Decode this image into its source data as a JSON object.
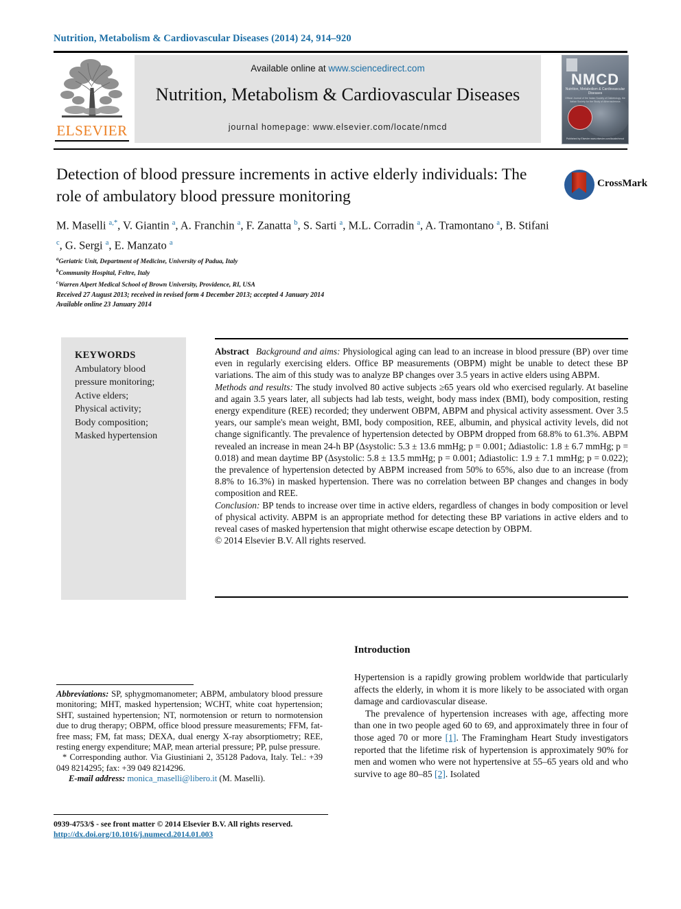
{
  "running_head": {
    "journal": "Nutrition, Metabolism & Cardiovascular Diseases",
    "citation": "(2014) ",
    "volume": "24",
    "pages": ", 914–920"
  },
  "masthead": {
    "available_prefix": "Available online at ",
    "sciencedirect_url": "www.sciencedirect.com",
    "journal_title": "Nutrition, Metabolism & Cardiovascular Diseases",
    "homepage": "journal homepage: www.elsevier.com/locate/nmcd",
    "publisher_name": "ELSEVIER",
    "cover": {
      "acronym": "NMCD",
      "subtitle": "Nutrition, Metabolism &\nCardiovascular Diseases",
      "tagline": "Official Journal of the Italian Society of Diabetology,\nthe Italian Society for the Study of Atherosclerosis",
      "footer": "Published by Elsevier\nwww.elsevier.com/locate/nmcd"
    }
  },
  "article": {
    "title": "Detection of blood pressure increments in active elderly individuals: The role of ambulatory blood pressure monitoring",
    "crossmark_label": "CrossMark",
    "authors": "M. Maselli a,*, V. Giantin a, A. Franchin a, F. Zanatta b, S. Sarti a, M.L. Corradin a, A. Tramontano a, B. Stifani c, G. Sergi a, E. Manzato a",
    "affiliations": [
      {
        "marker": "a",
        "text": "Geriatric Unit, Department of Medicine, University of Padua, Italy"
      },
      {
        "marker": "b",
        "text": "Community Hospital, Feltre, Italy"
      },
      {
        "marker": "c",
        "text": "Warren Alpert Medical School of Brown University, Providence, RI, USA"
      }
    ],
    "history_received": "Received 27 August 2013; received in revised form 4 December 2013; accepted 4 January 2014",
    "history_online": "Available online 23 January 2014"
  },
  "keywords": {
    "heading": "KEYWORDS",
    "items": [
      "Ambulatory blood pressure monitoring;",
      "Active elders;",
      "Physical activity;",
      "Body composition;",
      "Masked hypertension"
    ]
  },
  "abstract": {
    "label": "Abstract",
    "background_label": "Background and aims:",
    "background_text": " Physiological aging can lead to an increase in blood pressure (BP) over time even in regularly exercising elders. Office BP measurements (OBPM) might be unable to detect these BP variations. The aim of this study was to analyze BP changes over 3.5 years in active elders using ABPM.",
    "methods_label": "Methods and results:",
    "methods_text": " The study involved 80 active subjects ≥65 years old who exercised regularly. At baseline and again 3.5 years later, all subjects had lab tests, weight, body mass index (BMI), body composition, resting energy expenditure (REE) recorded; they underwent OBPM, ABPM and physical activity assessment. Over 3.5 years, our sample's mean weight, BMI, body composition, REE, albumin, and physical activity levels, did not change significantly. The prevalence of hypertension detected by OBPM dropped from 68.8% to 61.3%. ABPM revealed an increase in mean 24-h BP (Δsystolic: 5.3 ± 13.6 mmHg; p = 0.001; Δdiastolic: 1.8 ± 6.7 mmHg; p = 0.018) and mean daytime BP (Δsystolic: 5.8 ± 13.5 mmHg; p = 0.001; Δdiastolic: 1.9 ± 7.1 mmHg; p = 0.022); the prevalence of hypertension detected by ABPM increased from 50% to 65%, also due to an increase (from 8.8% to 16.3%) in masked hypertension. There was no correlation between BP changes and changes in body composition and REE.",
    "conclusion_label": "Conclusion:",
    "conclusion_text": " BP tends to increase over time in active elders, regardless of changes in body composition or level of physical activity. ABPM is an appropriate method for detecting these BP variations in active elders and to reveal cases of masked hypertension that might otherwise escape detection by OBPM.",
    "copyright": "© 2014 Elsevier B.V. All rights reserved."
  },
  "abbreviations": {
    "label": "Abbreviations:",
    "text": " SP, sphygmomanometer; ABPM, ambulatory blood pressure monitoring; MHT, masked hypertension; WCHT, white coat hypertension; SHT, sustained hypertension; NT, normotension or return to normotension due to drug therapy; OBPM, office blood pressure measurements; FFM, fat-free mass; FM, fat mass; DEXA, dual energy X-ray absorptiometry; REE, resting energy expenditure; MAP, mean arterial pressure; PP, pulse pressure.",
    "corresponding": "* Corresponding author. Via Giustiniani 2, 35128 Padova, Italy. Tel.: +39 049 8214295; fax: +39 049 8214296.",
    "email_label": "E-mail address:",
    "email": "monica_maselli@libero.it",
    "email_owner": " (M. Maselli)."
  },
  "introduction": {
    "heading": "Introduction",
    "paragraph1": "Hypertension is a rapidly growing problem worldwide that particularly affects the elderly, in whom it is more likely to be associated with organ damage and cardiovascular disease.",
    "p2_part1": "The prevalence of hypertension increases with age, affecting more than one in two people aged 60 to 69, and approximately three in four of those aged 70 or more ",
    "p2_ref1": "[1]",
    "p2_part2": ". The Framingham Heart Study investigators reported that the lifetime risk of hypertension is approximately 90% for men and women who were not hypertensive at 55–65 years old and who survive to age 80–85 ",
    "p2_ref2": "[2]",
    "p2_part3": ". Isolated"
  },
  "footer": {
    "copyright": "0939-4753/$ - see front matter © 2014 Elsevier B.V. All rights reserved.",
    "doi": "http://dx.doi.org/10.1016/j.numecd.2014.01.003"
  },
  "colors": {
    "link": "#1b6ea5",
    "elsevier_orange": "#ec8024",
    "panel_gray": "#e3e3e3"
  }
}
